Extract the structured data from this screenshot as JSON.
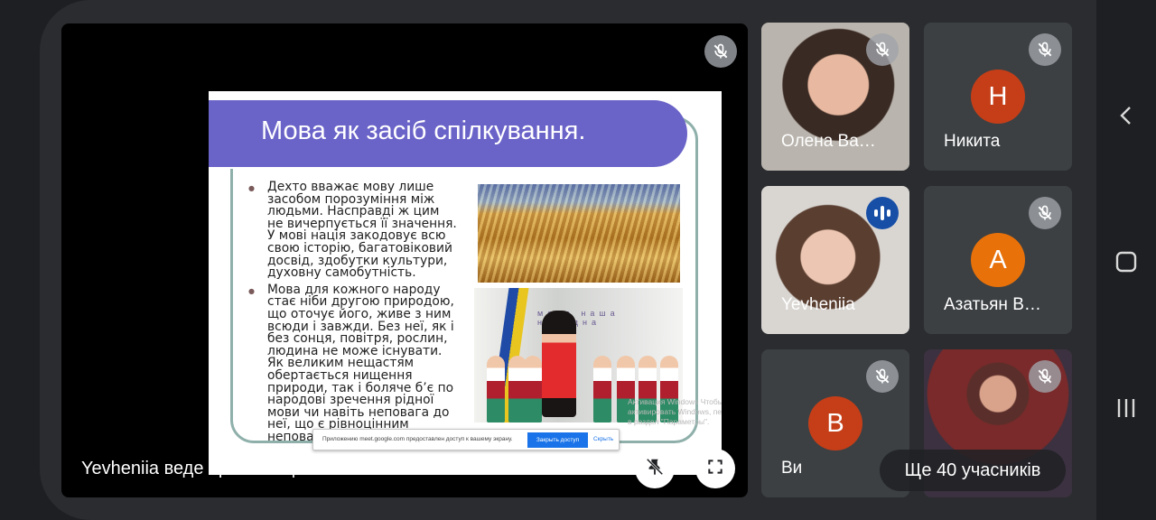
{
  "meeting": {
    "presenter_label": "Yevheniia веде презентацію",
    "more_participants": "Ще 40 учасників"
  },
  "slide": {
    "title": "Мова як засіб спілкування.",
    "bullets": [
      "Дехто вважає мову лише засобом порозуміння між людьми. Насправді ж цим не вичерпується її значення. У мові нація закодовує  всю свою історію, багатовіковий досвід, здобутки культури, духовну самобутність.",
      "Мова для кожного народу стає ніби другою природою, що оточує його, живе з ним всюди і завжди. Без неї, як і без сонця, повітря, рослин, людина не може існувати. Як великим нещастям обертається нищення природи, так і боляче б’є по народові зречення рідної мови чи навіть неповага до неї, що є рівноцінним неповазі до батька й матері."
    ],
    "photo_banner": "мова наша народна",
    "watermark": "Активация Windows Чтобы активировать Windows, перейдите в раздел \"Параметры\"."
  },
  "share_bar": {
    "text": "Приложению meet.google.com предоставлен доступ к вашему экрану.",
    "stop_label": "Закрыть доступ",
    "hide_label": "Скрыть"
  },
  "participants": [
    {
      "name": "Олена Ва…",
      "muted": true
    },
    {
      "name": "Никита",
      "initial": "Н",
      "color": "#c53e18",
      "muted": true
    },
    {
      "name": "Yevheniia",
      "muted": false,
      "speaking": true
    },
    {
      "name": "Азатьян В…",
      "initial": "А",
      "color": "#e8710a",
      "muted": true
    },
    {
      "name": "Ви",
      "initial": "В",
      "color": "#c53e18",
      "muted": true
    },
    {
      "name": "",
      "muted": true
    }
  ],
  "icons": {
    "unpin": "unpin-icon",
    "fullscreen": "fullscreen-icon",
    "mic_off": "mic-off-icon",
    "speaking": "audio-level-icon",
    "back": "back-icon",
    "home": "home-icon",
    "recents": "recents-icon"
  }
}
